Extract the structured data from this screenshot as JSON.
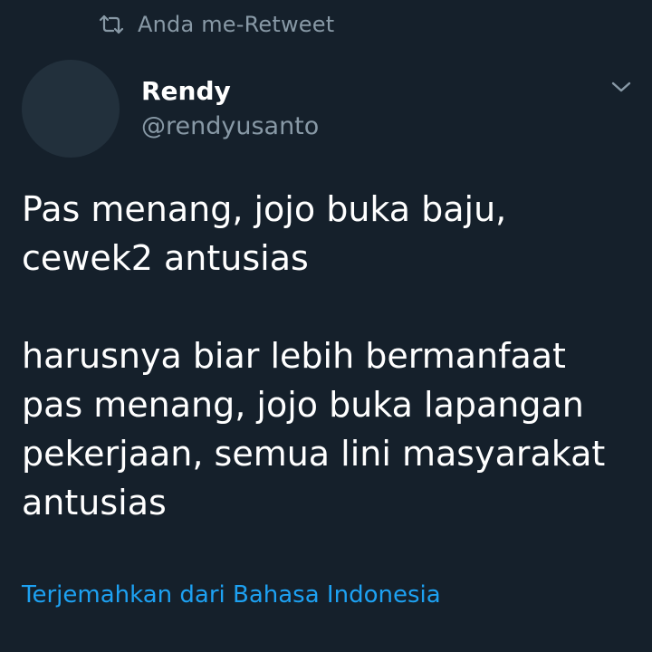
{
  "retweet_banner": {
    "label": "Anda me-Retweet",
    "icon": "retweet-icon"
  },
  "author": {
    "name": "Rendy",
    "handle": "@rendyusanto",
    "avatar_color": "#22303c"
  },
  "menu": {
    "icon": "chevron-down-icon"
  },
  "tweet": {
    "paragraph_1": [
      "Pas menang, jojo buka baju,",
      "cewek2 antusias"
    ],
    "paragraph_2": [
      "harusnya biar lebih bermanfaat",
      "pas menang, jojo buka lapangan",
      "pekerjaan, semua lini masyarakat",
      "antusias"
    ]
  },
  "translate_link": "Terjemahkan dari Bahasa Indonesia",
  "colors": {
    "background": "#15202b",
    "secondary_text": "#8899a6",
    "link": "#1da1f2",
    "primary_text": "#ffffff"
  }
}
